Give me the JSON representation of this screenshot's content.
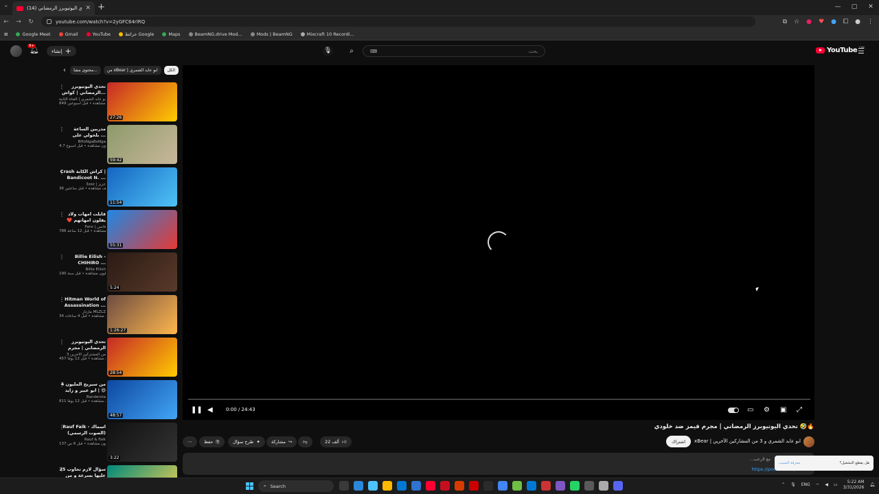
{
  "browser": {
    "tab_title": "(14) تحدي اليوتيوبرز الرمضاني |",
    "url": "youtube.com/watch?v=2yGFC64rlRQ",
    "bookmarks": [
      {
        "label": "Google Meet",
        "color": "#34a853"
      },
      {
        "label": "Gmail",
        "color": "#ea4335"
      },
      {
        "label": "YouTube",
        "color": "#ff0033"
      },
      {
        "label": "خرائط Google",
        "color": "#fbbc04"
      },
      {
        "label": "Maps",
        "color": "#34a853"
      },
      {
        "label": "BeamNG.drive Mod...",
        "color": "#888888"
      },
      {
        "label": "Mods | BeamNG",
        "color": "#888888"
      },
      {
        "label": "Mixcraft 10 Recordi...",
        "color": "#aaaaaa"
      }
    ]
  },
  "header": {
    "notification_count": "9+",
    "create_label": "إنشاء",
    "search_placeholder": "بحث",
    "logo_text": "YouTube",
    "logo_country": "OM"
  },
  "chips": [
    "الكل",
    "من xBear | ابو عابد الشمري",
    "محتوى مشا..."
  ],
  "player": {
    "time": "0:00 / 24:43",
    "progress": 0.0
  },
  "video": {
    "title": "تحدي اليوتيوبرز الرمضاني | مجرم قيمز ضد خلودي 🤣🔥",
    "channel": "xBear | ابو عابد الشمري و 3 من المشاركين الآخرين",
    "subscribe_label": "اشتراك",
    "like_count": "22 ألف",
    "share_label": "مشاركة",
    "ask_label": "طرح سؤال",
    "save_label": "حفظ",
    "description_link": "https://powrld.com/M-F15",
    "description_snippet": "...مع الرعب"
  },
  "popup": {
    "question": "هل يقطع التشغيل؟",
    "link": "معرفة السبب"
  },
  "recommendations": [
    {
      "title": "تحدي اليوتيوبرز الرمضاني | كواش...",
      "channel": "ابو عابد الشمري | القناة الثانية",
      "meta": "849 ألف مشاهدة • قبل أسبوعين",
      "duration": "27:26",
      "bg": "linear-gradient(135deg,#c62828,#ffcc00)"
    },
    {
      "title": "مدربين الساعة بلحولي على ...",
      "channel": "BHoNgaBoNga",
      "meta": "4.7 مليون مشاهدة • قبل أسبوع",
      "duration": "59:42",
      "bg": "linear-gradient(135deg,#8d9a6a,#c8b79a)"
    },
    {
      "title": "Crash كراش الكابة | Bandicoot N. ...",
      "channel": "3zez | عزيز",
      "meta": "36 ألف مشاهدة • قبل ساعتين",
      "duration": "11:54",
      "bg": "linear-gradient(135deg,#1565c0,#4fc3f7)"
    },
    {
      "title": "قابلت امهات ولاد يقلون امهاتهم ❤️ 8#",
      "channel": "Fans | فانس",
      "meta": "786 ألف مشاهدة • قبل 12 ساعة",
      "duration": "55:31",
      "bg": "linear-gradient(135deg,#1e88e5,#e53935)"
    },
    {
      "title": "Billie Eilish - CHIHIRO ...",
      "channel": "Billie Eilish",
      "meta": "190 مليون مشاهدة • قبل سنة",
      "duration": "5:24",
      "bg": "linear-gradient(135deg,#2a1a14,#5a3a2a)"
    },
    {
      "title": "Hitman World of Assassination ...",
      "channel": "مازداز MLZLZ",
      "meta": "34 ألف مشاهدة • قبل 4 ساعات",
      "duration": "1:26:27",
      "bg": "linear-gradient(135deg,#6d4c41,#ffb74d)"
    },
    {
      "title": "تحدي اليوتيوبرز الرمضاني | مجرم قي...",
      "channel": "3 من المشتركين الآخرين",
      "meta": "457 ألف مشاهدة • قبل 12 يومًا",
      "duration": "28:54",
      "bg": "linear-gradient(135deg,#c62828,#ffcc00)"
    },
    {
      "title": "من سيربح المليون 4 | ابو عبير و زايد 😄",
      "channel": "Bandersta",
      "meta": "811 ألف مشاهدة • قبل 12 يومًا",
      "duration": "48:57",
      "bg": "linear-gradient(135deg,#0d47a1,#42a5f5)"
    },
    {
      "title": "Rauf Faik - اسماك (الصوت الرسمي)",
      "channel": "Rauf & Faik",
      "meta": "137 مليون مشاهدة • قبل 6 س...",
      "duration": "3:22",
      "bg": "linear-gradient(135deg,#111111,#333333)"
    },
    {
      "title": "25 سؤال لازم تجاوب عليها بسرعة و من غ...",
      "channel": "",
      "meta": "",
      "duration": "",
      "bg": "linear-gradient(135deg,#00897b,#ffd54f)"
    }
  ],
  "taskbar": {
    "search_label": "Search",
    "language": "ENG",
    "time": "5:22 AM",
    "date": "3/31/2026",
    "app_colors": [
      "#3a3a3a",
      "#2b88d8",
      "#4cc2ff",
      "#ffb900",
      "#0078d4",
      "#2f74d0",
      "#ff0033",
      "#c50f1f",
      "#d83b01",
      "#cc0000",
      "#2b2b2b",
      "#4285f4",
      "#6fbf44",
      "#0078d4",
      "#cc3333",
      "#7e57c2",
      "#25d366",
      "#5a5a5a",
      "#aaaaaa",
      "#5865f2"
    ]
  }
}
